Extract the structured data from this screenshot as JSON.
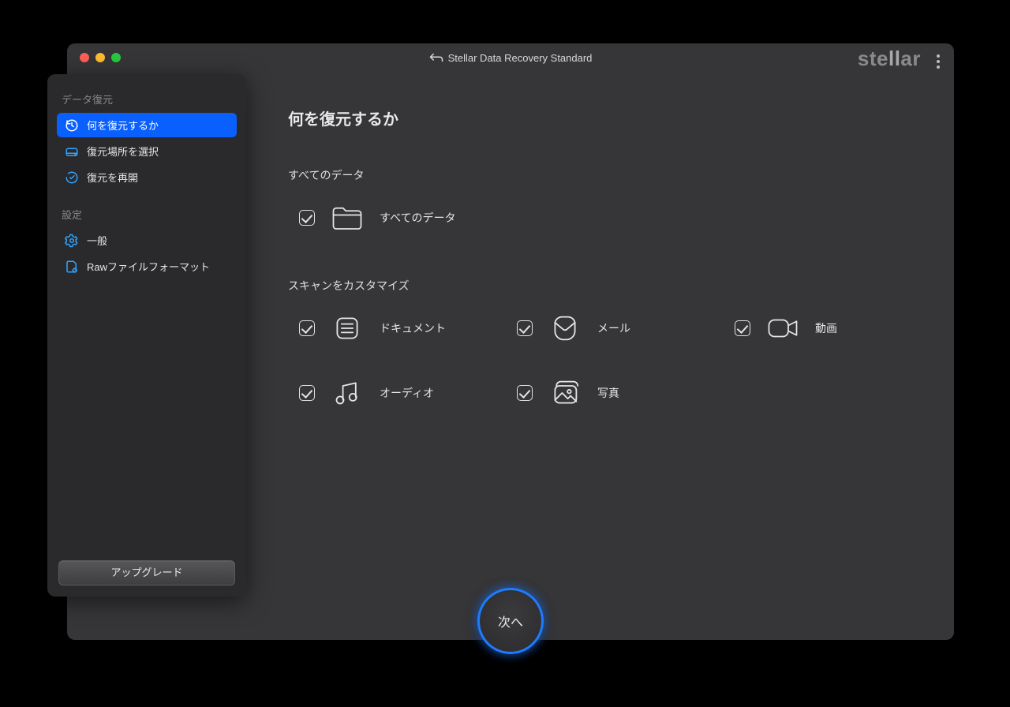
{
  "window": {
    "title": "Stellar Data Recovery Standard",
    "brand": "stellar"
  },
  "sidebar": {
    "sections": {
      "recovery": "データ復元",
      "settings": "設定"
    },
    "items": {
      "what": "何を復元するか",
      "location": "復元場所を選択",
      "resume": "復元を再開",
      "general": "一般",
      "raw": "Rawファイルフォーマット"
    },
    "upgrade": "アップグレード"
  },
  "main": {
    "title": "何を復元するか",
    "section_all": "すべてのデータ",
    "all_label": "すべてのデータ",
    "section_custom": "スキャンをカスタマイズ",
    "types": {
      "documents": "ドキュメント",
      "emails": "メール",
      "videos": "動画",
      "audio": "オーディオ",
      "photos": "写真"
    },
    "next": "次へ"
  }
}
